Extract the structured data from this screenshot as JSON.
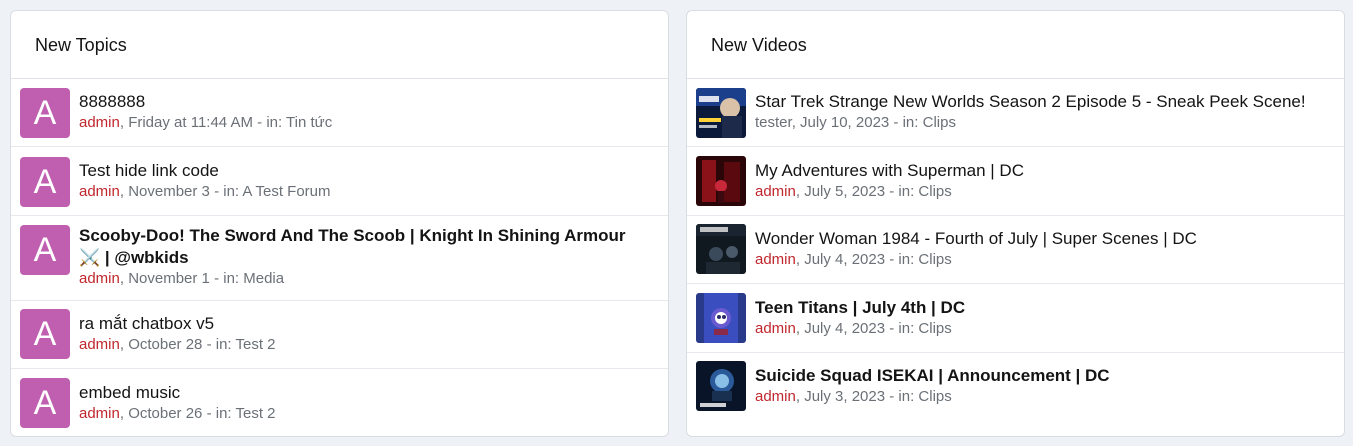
{
  "topics": {
    "header": "New Topics",
    "items": [
      {
        "avatar": "A",
        "title": "8888888",
        "bold": false,
        "author": "admin",
        "date": ", Friday at 11:44 AM",
        "forum": " - in: Tin tức"
      },
      {
        "avatar": "A",
        "title": "Test hide link code",
        "bold": false,
        "author": "admin",
        "date": ", November 3",
        "forum": " - in: A Test Forum"
      },
      {
        "avatar": "A",
        "title": "Scooby-Doo! The Sword And The Scoob | Knight In Shining Armour ⚔️ | @wbkids",
        "bold": true,
        "author": "admin",
        "date": ", November 1",
        "forum": " - in: Media"
      },
      {
        "avatar": "A",
        "title": "ra mắt chatbox v5",
        "bold": false,
        "author": "admin",
        "date": ", October 28",
        "forum": " - in: Test 2"
      },
      {
        "avatar": "A",
        "title": "embed music",
        "bold": false,
        "author": "admin",
        "date": ", October 26",
        "forum": " - in: Test 2"
      }
    ]
  },
  "videos": {
    "header": "New Videos",
    "items": [
      {
        "title": "Star Trek Strange New Worlds Season 2 Episode 5 - Sneak Peek Scene!",
        "bold": false,
        "author": "tester",
        "date": ", July 10, 2023",
        "forum": " - in: Clips"
      },
      {
        "title": "My Adventures with Superman | DC",
        "bold": false,
        "author": "admin",
        "date": ", July 5, 2023",
        "forum": " - in: Clips"
      },
      {
        "title": "Wonder Woman 1984 - Fourth of July | Super Scenes | DC",
        "bold": false,
        "author": "admin",
        "date": ", July 4, 2023",
        "forum": " - in: Clips"
      },
      {
        "title": "Teen Titans | July 4th | DC",
        "bold": true,
        "author": "admin",
        "date": ", July 4, 2023",
        "forum": " - in: Clips"
      },
      {
        "title": "Suicide Squad ISEKAI | Announcement | DC",
        "bold": true,
        "author": "admin",
        "date": ", July 3, 2023",
        "forum": " - in: Clips"
      }
    ]
  },
  "colors": {
    "avatar": "#c05fb0",
    "author": "#c0272d",
    "meta": "#6b7077"
  }
}
